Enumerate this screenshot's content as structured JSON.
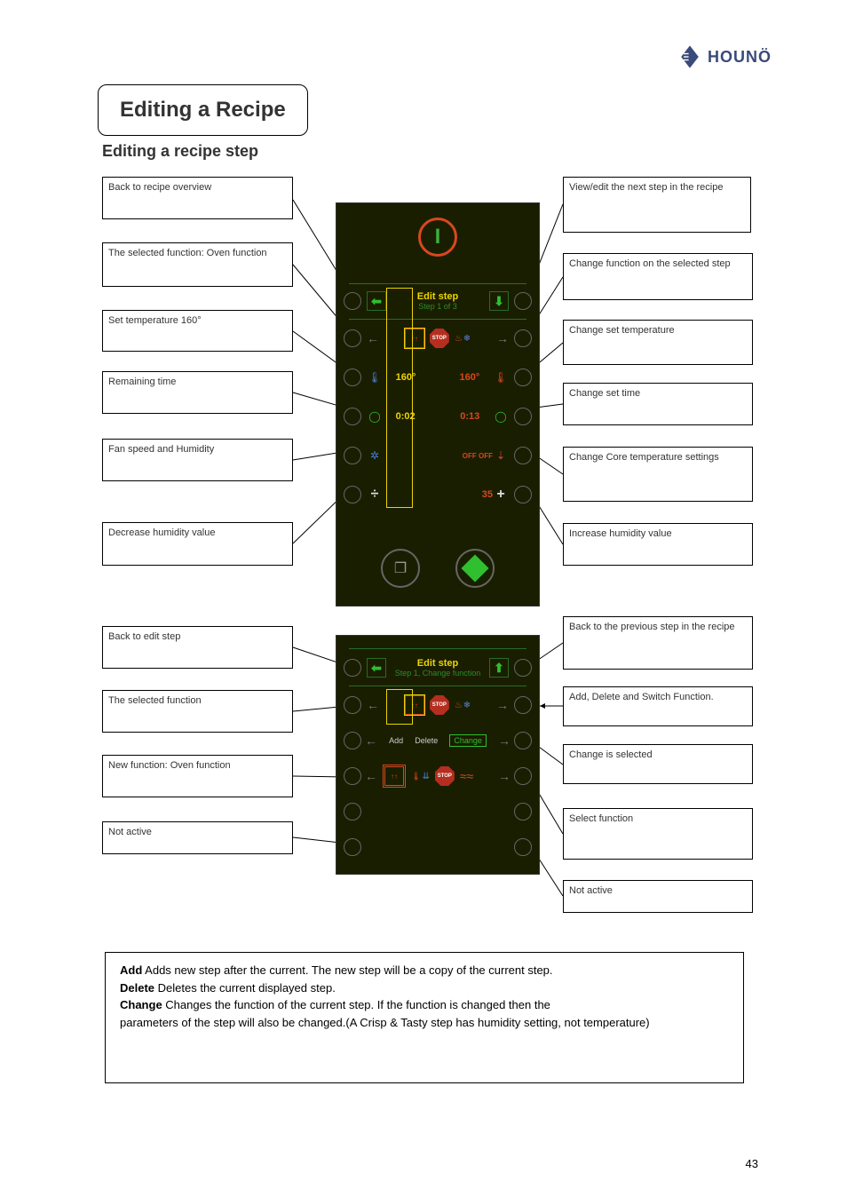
{
  "brand": "HOUNÖ",
  "page_number": "43",
  "title": "Editing a Recipe",
  "subtitle": "Editing a recipe step",
  "panel1": {
    "header_title": "Edit step",
    "header_sub": "Step 1 of 3",
    "temp_left": "160°",
    "temp_right": "160°",
    "time_left": "0:02",
    "time_right": "0:13",
    "core_left": "",
    "core_right": "OFF OFF",
    "humidity_right": "35",
    "stop_label": "STOP"
  },
  "panel2": {
    "header_title": "Edit step",
    "header_sub": "Step 1, Change function",
    "menu_add": "Add",
    "menu_delete": "Delete",
    "menu_change": "Change",
    "stop_label": "STOP"
  },
  "callouts1": {
    "l1": "Back to recipe overview",
    "l2": "The selected function: Oven function",
    "l3": "Set temperature 160°",
    "l4": "Remaining time",
    "l5": "Fan speed and Humidity",
    "l6": "Decrease humidity value",
    "r1": "View/edit the next step in the recipe",
    "r2": "Change function on the selected step",
    "r3": "Change set temperature",
    "r4": "Change set time",
    "r5": "Change Core temperature settings",
    "r6": "Increase humidity value"
  },
  "callouts2": {
    "l1": "Back to edit step",
    "l2": "The selected function",
    "l3": "New function: Oven function",
    "l4": "Not active",
    "r1": "Back to the previous step in the recipe",
    "r2": "Add, Delete and Switch Function.",
    "r3": "Change is selected",
    "r4": "Select function",
    "r5": "Not active"
  },
  "note": {
    "line1_bold": "Add",
    "line1_rest": " Adds new step after the current. The new step will be a copy of the current step.",
    "line2_bold": "Delete",
    "line2_rest": " Deletes the current displayed step.",
    "line3_bold": "Change",
    "line3_rest": " Changes the function of the current step. If the function is changed then the",
    "line4": "parameters of the step will also be changed.(A Crisp & Tasty step has humidity setting, not temperature)"
  }
}
